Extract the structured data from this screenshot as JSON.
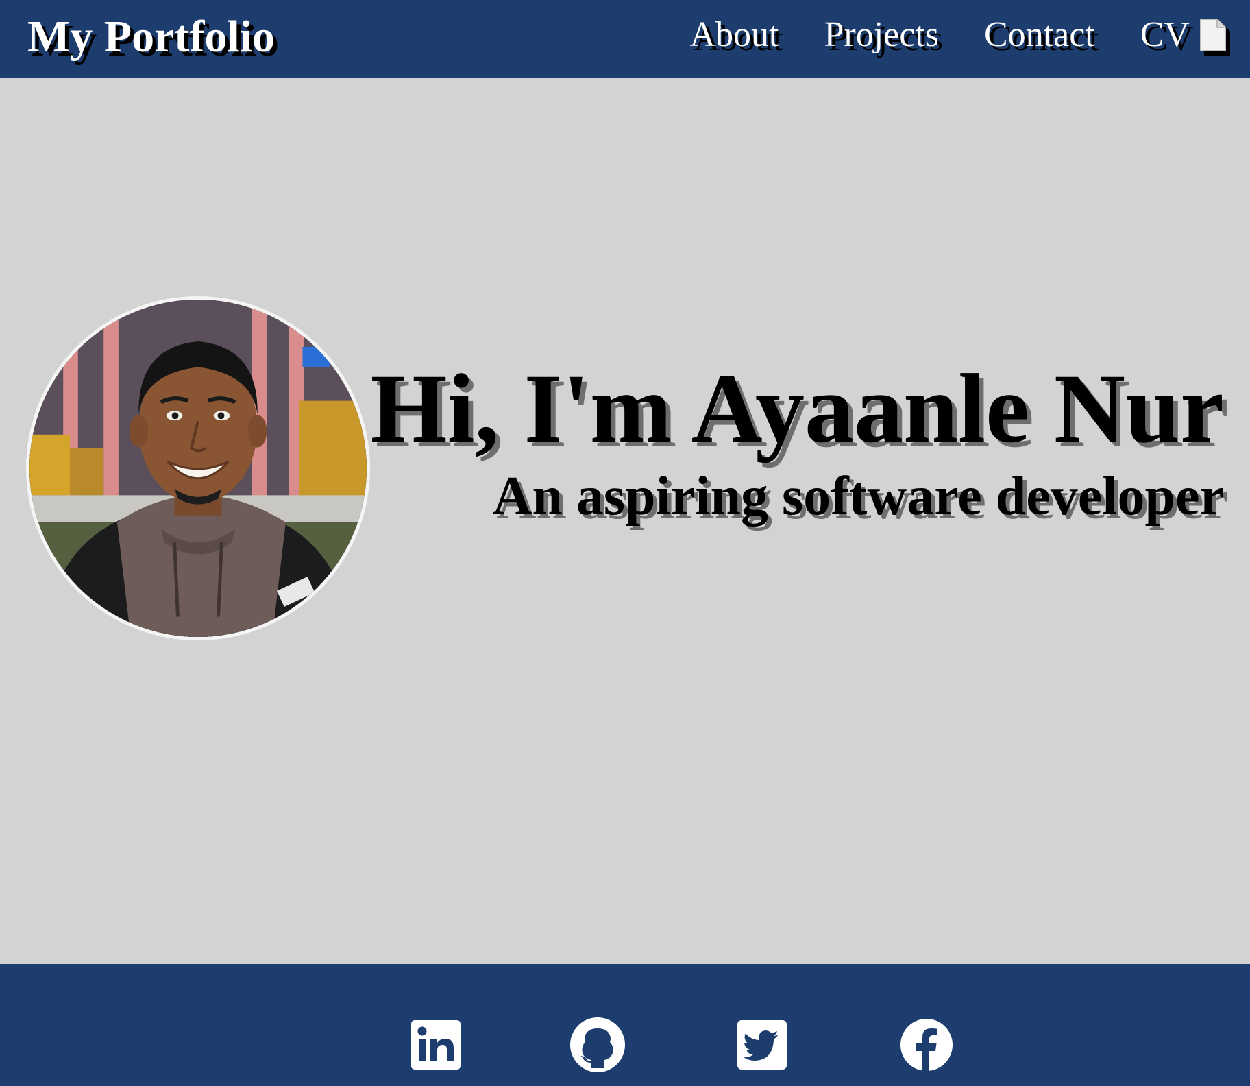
{
  "header": {
    "brand": "My Portfolio",
    "nav": {
      "about": "About",
      "projects": "Projects",
      "contact": "Contact",
      "cv": "CV"
    },
    "cv_icon": "document-icon"
  },
  "hero": {
    "title": "Hi, I'm Ayaanle Nur",
    "subtitle": "An aspiring software developer",
    "photo_icon": "profile-photo"
  },
  "footer": {
    "social": [
      {
        "icon": "linkedin-icon"
      },
      {
        "icon": "github-icon"
      },
      {
        "icon": "twitter-icon"
      },
      {
        "icon": "facebook-icon"
      }
    ]
  },
  "colors": {
    "header_bg": "#1c3d6d",
    "page_bg": "#d3d3d3",
    "footer_bg": "#1c3d6d",
    "nav_text": "#ffffff",
    "hero_text": "#000000"
  }
}
